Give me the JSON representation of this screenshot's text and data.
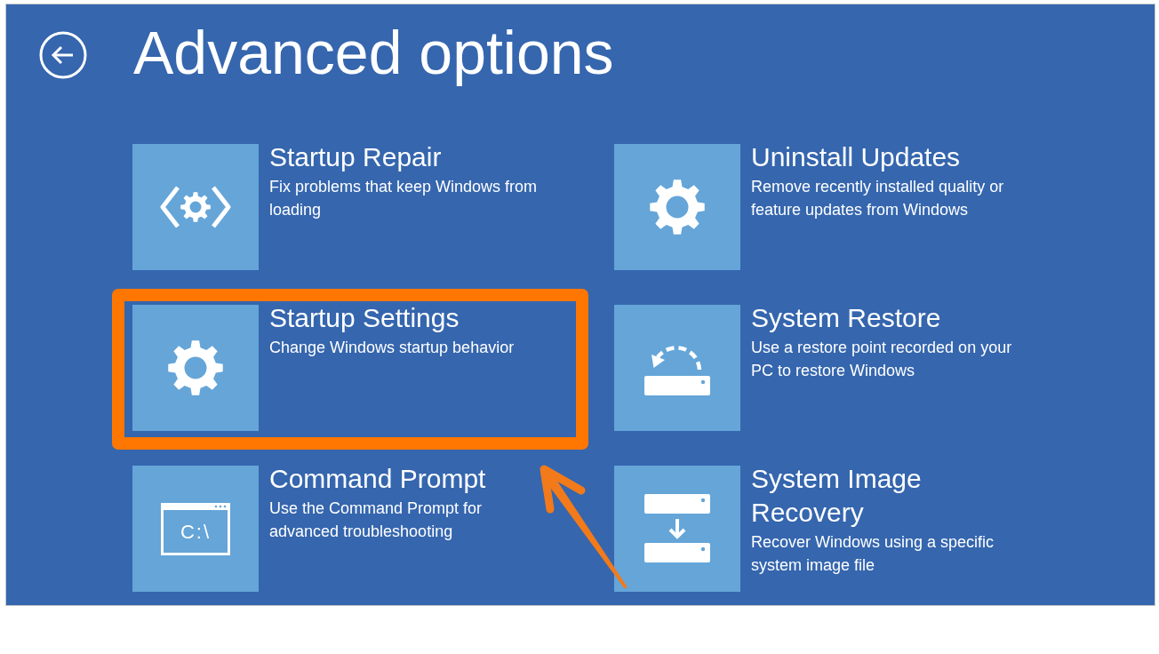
{
  "header": {
    "title": "Advanced options"
  },
  "options": [
    {
      "kind": "repair",
      "title": "Startup Repair",
      "description": "Fix problems that keep Windows from loading",
      "highlighted": false
    },
    {
      "kind": "gear",
      "title": "Uninstall Updates",
      "description": "Remove recently installed quality or feature updates from Windows",
      "highlighted": false
    },
    {
      "kind": "gear",
      "title": "Startup Settings",
      "description": "Change Windows startup behavior",
      "highlighted": true
    },
    {
      "kind": "restore",
      "title": "System Restore",
      "description": "Use a restore point recorded on your PC to restore Windows",
      "highlighted": false
    },
    {
      "kind": "command-prompt",
      "icon_text": "C:\\",
      "title": "Command Prompt",
      "description": "Use the Command Prompt for advanced troubleshooting",
      "highlighted": false
    },
    {
      "kind": "image-recovery",
      "title": "System Image Recovery",
      "description": "Recover Windows using a specific system image file",
      "highlighted": false
    }
  ]
}
